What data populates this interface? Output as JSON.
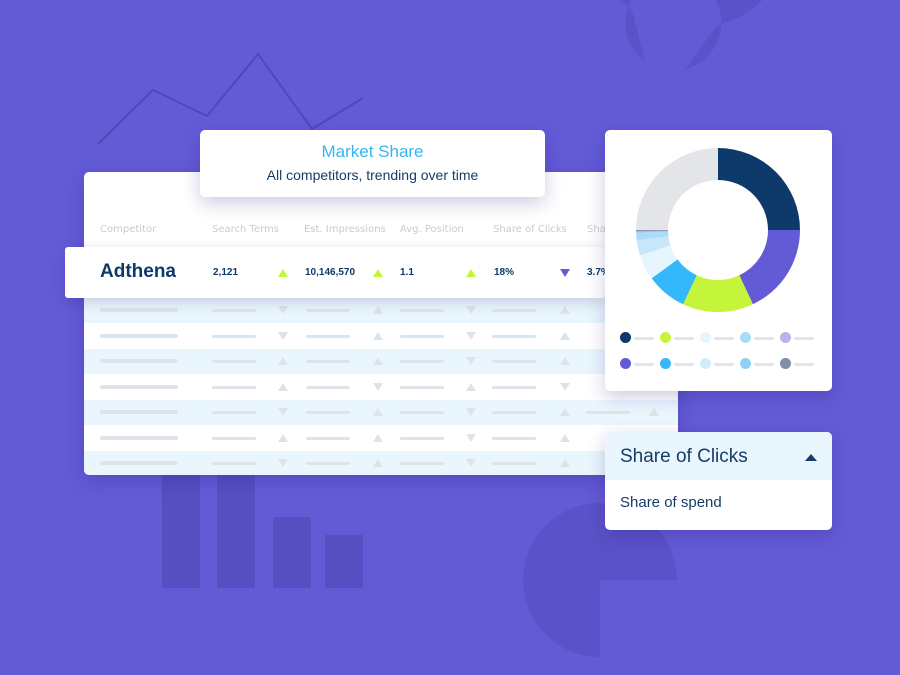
{
  "colors": {
    "background": "#635bd6",
    "accent_blue": "#35b5f5",
    "navy": "#0d3a6a",
    "lime": "#c5f53a",
    "purple": "#635bd6"
  },
  "title_card": {
    "title": "Market Share",
    "subtitle": "All competitors, trending over time"
  },
  "table": {
    "columns": [
      "Competitor",
      "Search Terms",
      "Est. Impressions",
      "Avg. Position",
      "Share of Clicks",
      "Sha"
    ],
    "highlight_row": {
      "competitor": "Adthena",
      "search_terms": "2,121",
      "search_terms_trend": "up",
      "est_impressions": "10,146,570",
      "est_impressions_trend": "up",
      "avg_position": "1.1",
      "avg_position_trend": "up",
      "share_of_clicks": "18%",
      "share_of_clicks_trend": "down",
      "next_column_value": "3.7%"
    },
    "placeholder_rows": [
      {
        "trends": [
          "down",
          "up",
          "down",
          "up"
        ]
      },
      {
        "trends": [
          "down",
          "up",
          "down",
          "up"
        ]
      },
      {
        "trends": [
          "up",
          "up",
          "down",
          "up"
        ]
      },
      {
        "trends": [
          "up",
          "down",
          "up",
          "down"
        ]
      },
      {
        "trends": [
          "down",
          "up",
          "down",
          "up",
          "up"
        ]
      },
      {
        "trends": [
          "up",
          "up",
          "down",
          "up"
        ]
      },
      {
        "trends": [
          "down",
          "up",
          "down",
          "up"
        ]
      }
    ]
  },
  "chart_data": {
    "type": "pie",
    "title": "",
    "donut": true,
    "slices": [
      {
        "label": "",
        "value": 25,
        "color": "#0d3a6a"
      },
      {
        "label": "",
        "value": 18,
        "color": "#635bd6"
      },
      {
        "label": "",
        "value": 14,
        "color": "#c5f53a"
      },
      {
        "label": "",
        "value": 8,
        "color": "#33b8fb"
      },
      {
        "label": "",
        "value": 5,
        "color": "#e6f6fe"
      },
      {
        "label": "",
        "value": 3,
        "color": "#c6e7fb"
      },
      {
        "label": "",
        "value": 1.5,
        "color": "#a8dcf8"
      },
      {
        "label": "",
        "value": 0.3,
        "color": "#b9b2ee"
      },
      {
        "label": "",
        "value": 0.2,
        "color": "#7f8fa8"
      },
      {
        "label": "",
        "value": 25,
        "color": "#e4e5e8"
      }
    ],
    "legend": {
      "placement": "bottom",
      "entries": [
        {
          "color": "#0d3a6a"
        },
        {
          "color": "#c5f53a"
        },
        {
          "color": "#e6f6fe"
        },
        {
          "color": "#a8dcf8"
        },
        {
          "color": "#b9b2ee"
        },
        {
          "color": "#635bd6"
        },
        {
          "color": "#33b8fb"
        },
        {
          "color": "#d2ebfa"
        },
        {
          "color": "#8fd0f5"
        },
        {
          "color": "#7f8fa8"
        }
      ]
    }
  },
  "dropdown": {
    "selected": "Share of Clicks",
    "options": [
      "Share of spend"
    ],
    "caret_icon": "caret-up-icon"
  }
}
